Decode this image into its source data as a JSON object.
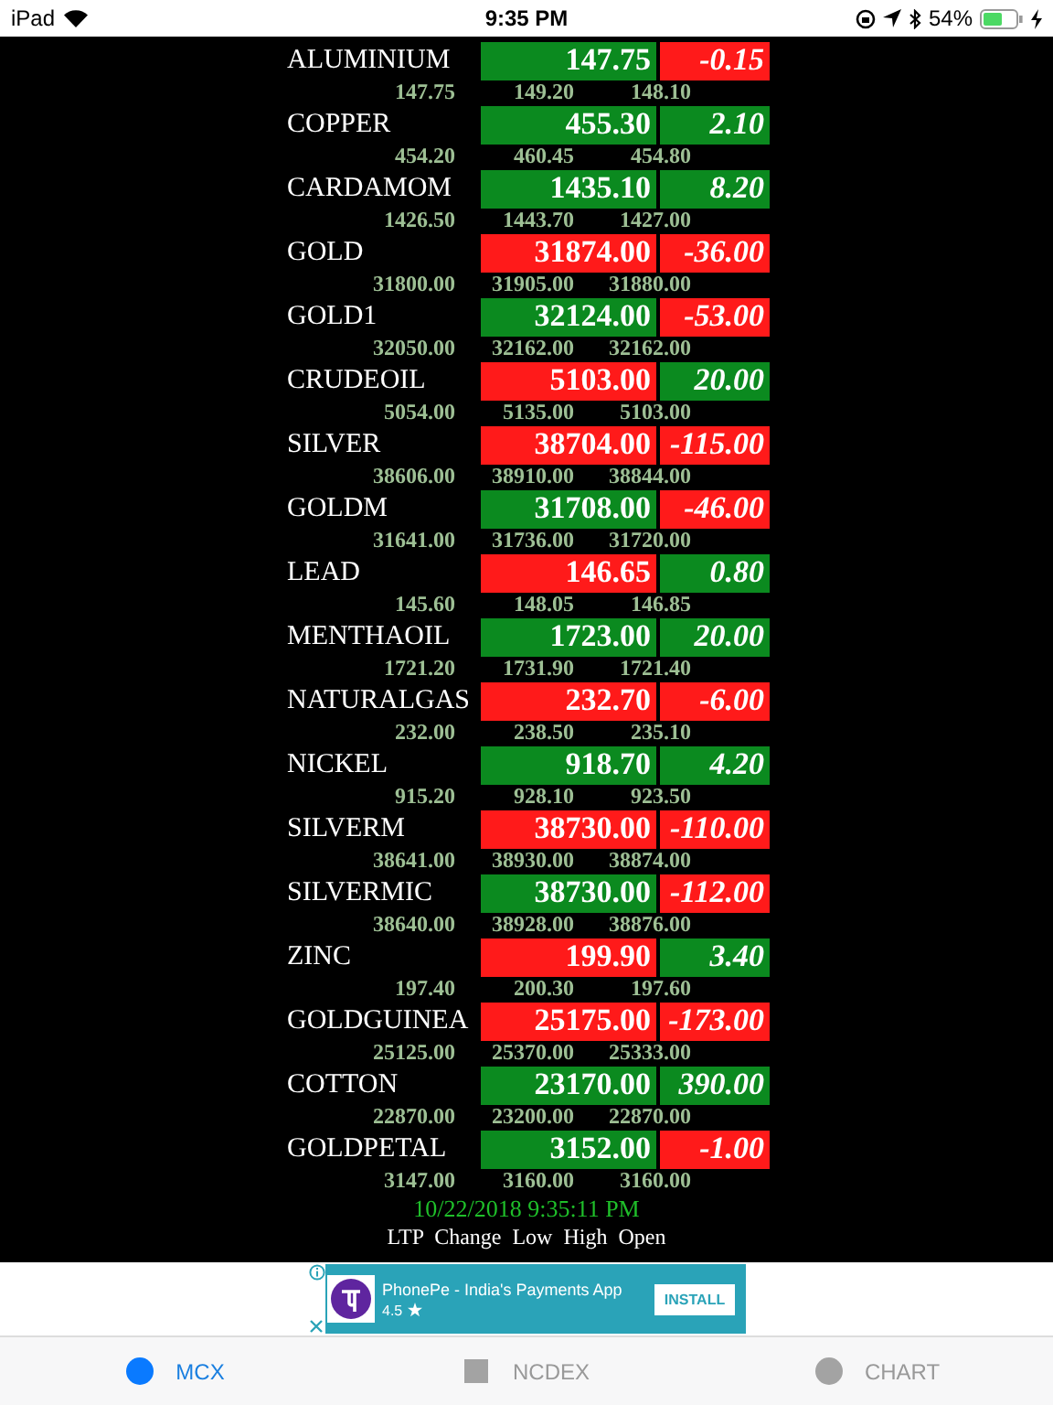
{
  "status_bar": {
    "device": "iPad",
    "time": "9:35 PM",
    "battery": "54%"
  },
  "rows": [
    {
      "name": "ALUMINIUM",
      "ltp": "147.75",
      "ltp_up": true,
      "change": "-0.15",
      "change_up": false,
      "low": "147.75",
      "high": "149.20",
      "open": "148.10"
    },
    {
      "name": "COPPER",
      "ltp": "455.30",
      "ltp_up": true,
      "change": "2.10",
      "change_up": true,
      "low": "454.20",
      "high": "460.45",
      "open": "454.80"
    },
    {
      "name": "CARDAMOM",
      "ltp": "1435.10",
      "ltp_up": true,
      "change": "8.20",
      "change_up": true,
      "low": "1426.50",
      "high": "1443.70",
      "open": "1427.00"
    },
    {
      "name": "GOLD",
      "ltp": "31874.00",
      "ltp_up": false,
      "change": "-36.00",
      "change_up": false,
      "low": "31800.00",
      "high": "31905.00",
      "open": "31880.00"
    },
    {
      "name": "GOLD1",
      "ltp": "32124.00",
      "ltp_up": true,
      "change": "-53.00",
      "change_up": false,
      "low": "32050.00",
      "high": "32162.00",
      "open": "32162.00"
    },
    {
      "name": "CRUDEOIL",
      "ltp": "5103.00",
      "ltp_up": false,
      "change": "20.00",
      "change_up": true,
      "low": "5054.00",
      "high": "5135.00",
      "open": "5103.00"
    },
    {
      "name": "SILVER",
      "ltp": "38704.00",
      "ltp_up": false,
      "change": "-115.00",
      "change_up": false,
      "low": "38606.00",
      "high": "38910.00",
      "open": "38844.00"
    },
    {
      "name": "GOLDM",
      "ltp": "31708.00",
      "ltp_up": true,
      "change": "-46.00",
      "change_up": false,
      "low": "31641.00",
      "high": "31736.00",
      "open": "31720.00"
    },
    {
      "name": "LEAD",
      "ltp": "146.65",
      "ltp_up": false,
      "change": "0.80",
      "change_up": true,
      "low": "145.60",
      "high": "148.05",
      "open": "146.85"
    },
    {
      "name": "MENTHAOIL",
      "ltp": "1723.00",
      "ltp_up": true,
      "change": "20.00",
      "change_up": true,
      "low": "1721.20",
      "high": "1731.90",
      "open": "1721.40"
    },
    {
      "name": "NATURALGAS",
      "ltp": "232.70",
      "ltp_up": false,
      "change": "-6.00",
      "change_up": false,
      "low": "232.00",
      "high": "238.50",
      "open": "235.10"
    },
    {
      "name": "NICKEL",
      "ltp": "918.70",
      "ltp_up": true,
      "change": "4.20",
      "change_up": true,
      "low": "915.20",
      "high": "928.10",
      "open": "923.50"
    },
    {
      "name": "SILVERM",
      "ltp": "38730.00",
      "ltp_up": false,
      "change": "-110.00",
      "change_up": false,
      "low": "38641.00",
      "high": "38930.00",
      "open": "38874.00"
    },
    {
      "name": "SILVERMIC",
      "ltp": "38730.00",
      "ltp_up": true,
      "change": "-112.00",
      "change_up": false,
      "low": "38640.00",
      "high": "38928.00",
      "open": "38876.00"
    },
    {
      "name": "ZINC",
      "ltp": "199.90",
      "ltp_up": false,
      "change": "3.40",
      "change_up": true,
      "low": "197.40",
      "high": "200.30",
      "open": "197.60"
    },
    {
      "name": "GOLDGUINEA",
      "ltp": "25175.00",
      "ltp_up": false,
      "change": "-173.00",
      "change_up": false,
      "low": "25125.00",
      "high": "25370.00",
      "open": "25333.00"
    },
    {
      "name": "COTTON",
      "ltp": "23170.00",
      "ltp_up": true,
      "change": "390.00",
      "change_up": true,
      "low": "22870.00",
      "high": "23200.00",
      "open": "22870.00"
    },
    {
      "name": "GOLDPETAL",
      "ltp": "3152.00",
      "ltp_up": true,
      "change": "-1.00",
      "change_up": false,
      "low": "3147.00",
      "high": "3160.00",
      "open": "3160.00"
    }
  ],
  "updated": "10/22/2018 9:35:11 PM",
  "legend": "LTP  Change  Low  High  Open",
  "ad": {
    "title": "PhonePe - India's Payments App",
    "rating": "4.5",
    "button": "INSTALL"
  },
  "tabs": [
    {
      "label": "MCX",
      "kind": "circle",
      "selected": true
    },
    {
      "label": "NCDEX",
      "kind": "square",
      "selected": false
    },
    {
      "label": "CHART",
      "kind": "circle",
      "selected": false
    }
  ]
}
